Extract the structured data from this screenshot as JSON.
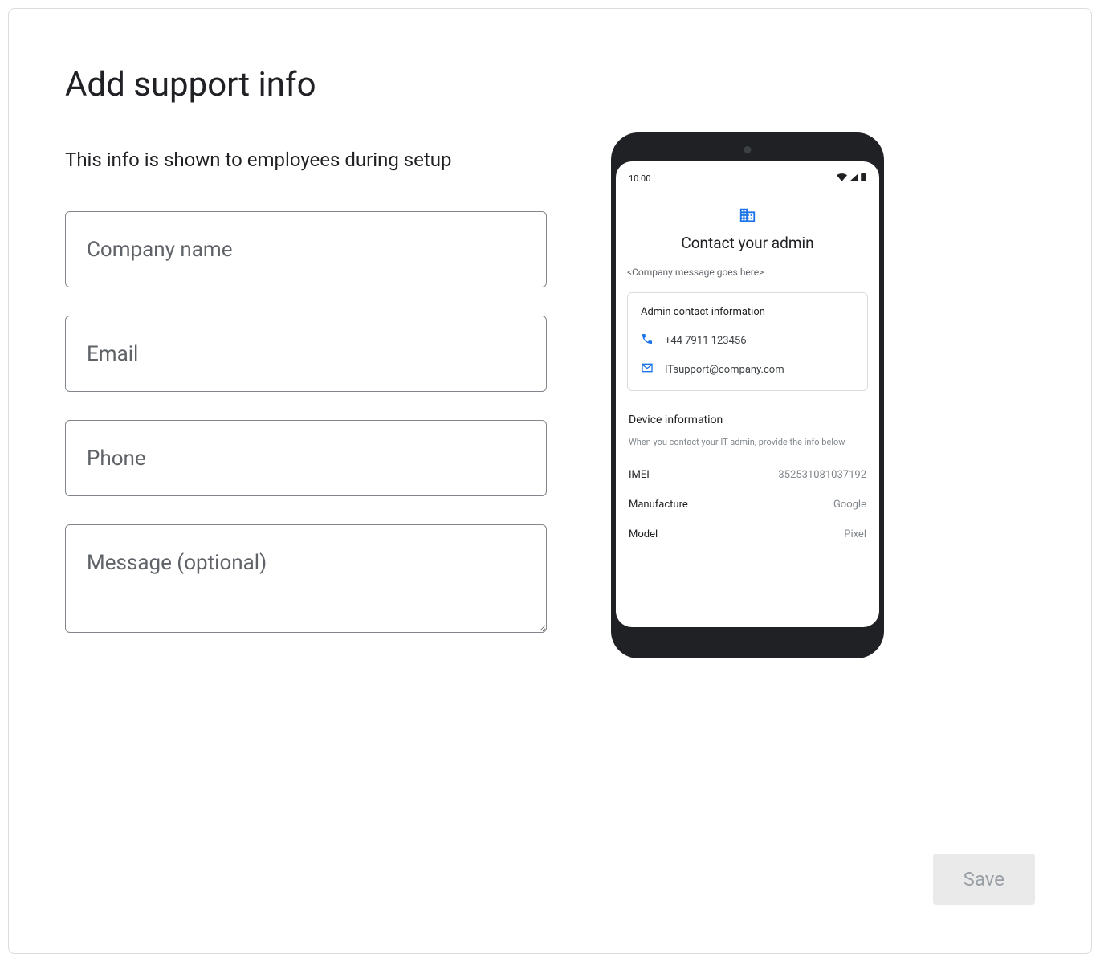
{
  "page": {
    "title": "Add support info",
    "subtitle": "This info is shown to employees during setup"
  },
  "form": {
    "company_name_placeholder": "Company name",
    "email_placeholder": "Email",
    "phone_placeholder": "Phone",
    "message_placeholder": "Message (optional)"
  },
  "phone_preview": {
    "time": "10:00",
    "contact_title": "Contact your admin",
    "company_message": "<Company message goes here>",
    "admin_card_title": "Admin contact information",
    "phone_number": "+44 7911 123456",
    "email": "ITsupport@company.com",
    "device_title": "Device information",
    "device_subtitle": "When you contact your IT admin, provide the info below",
    "imei_label": "IMEI",
    "imei_value": "352531081037192",
    "manufacture_label": "Manufacture",
    "manufacture_value": "Google",
    "model_label": "Model",
    "model_value": "Pixel"
  },
  "actions": {
    "save_label": "Save"
  }
}
